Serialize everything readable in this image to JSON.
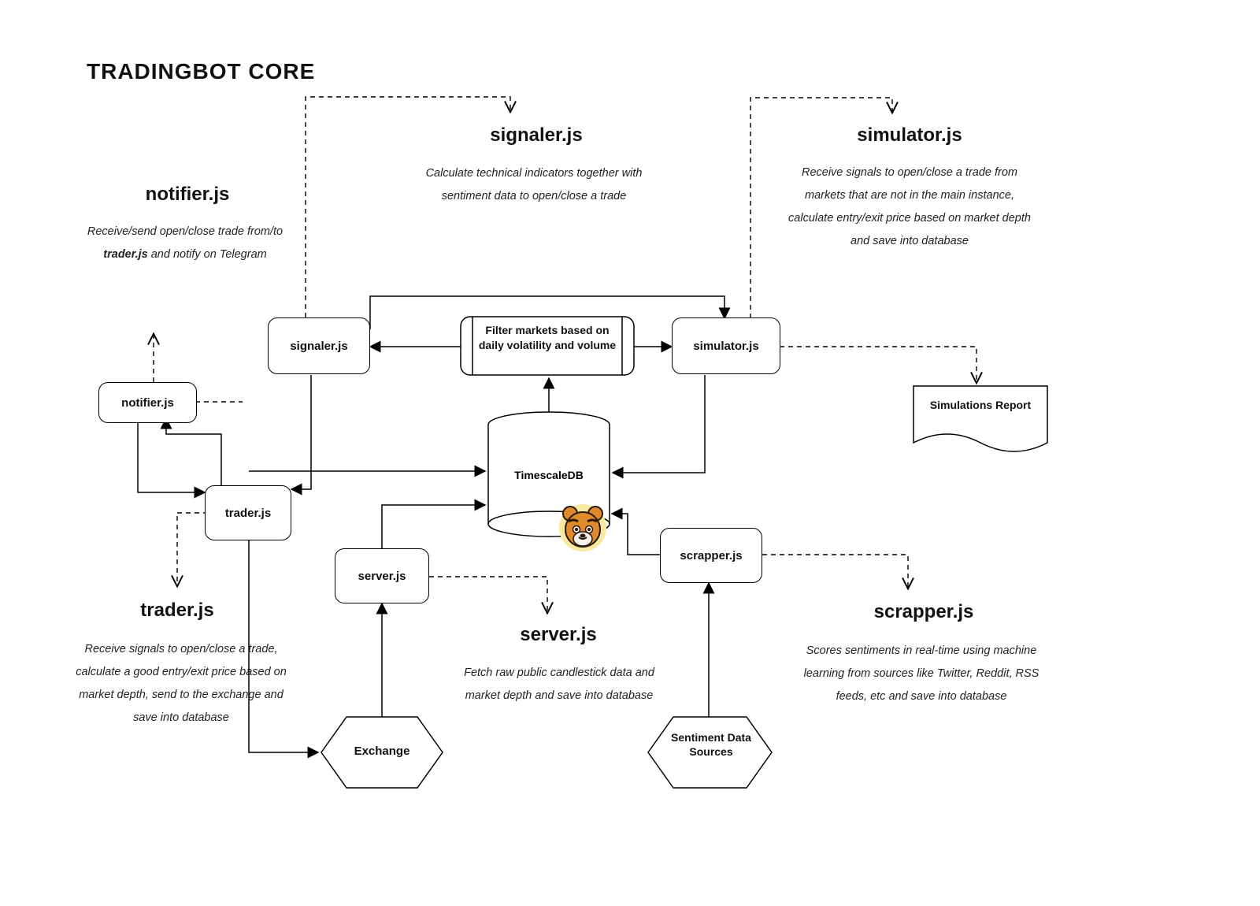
{
  "title": "TRADINGBOT CORE",
  "modules": {
    "notifier": {
      "title": "notifier.js",
      "desc_html": "Receive/send open/close trade from/to <b>trader.js</b> and notify on Telegram"
    },
    "signaler": {
      "title": "signaler.js",
      "desc": "Calculate technical indicators together with sentiment data to open/close a trade"
    },
    "simulator": {
      "title": "simulator.js",
      "desc": "Receive signals to open/close a trade from markets that are not in the main instance, calculate entry/exit price based on market depth and save into database"
    },
    "trader": {
      "title": "trader.js",
      "desc": "Receive signals to open/close a trade, calculate a good entry/exit price based on market depth, send to the exchange and save into database"
    },
    "server": {
      "title": "server.js",
      "desc": "Fetch raw public candlestick data and market depth and save into database"
    },
    "scrapper": {
      "title": "scrapper.js",
      "desc": "Scores sentiments in real-time using machine learning from sources like Twitter, Reddit, RSS feeds, etc and save into database"
    }
  },
  "nodes": {
    "notifier": "notifier.js",
    "signaler": "signaler.js",
    "simulator": "simulator.js",
    "trader": "trader.js",
    "server": "server.js",
    "scrapper": "scrapper.js",
    "filter": "Filter markets based on daily volatility and volume",
    "db": "TimescaleDB",
    "exchange": "Exchange",
    "sentiment": "Sentiment Data Sources",
    "report": "Simulations Report"
  },
  "icon": {
    "name": "tiger-icon",
    "bg": "#f8e9a1",
    "fur": "#e08a2c",
    "dark": "#2a1a0e",
    "light": "#f6f3ee"
  }
}
